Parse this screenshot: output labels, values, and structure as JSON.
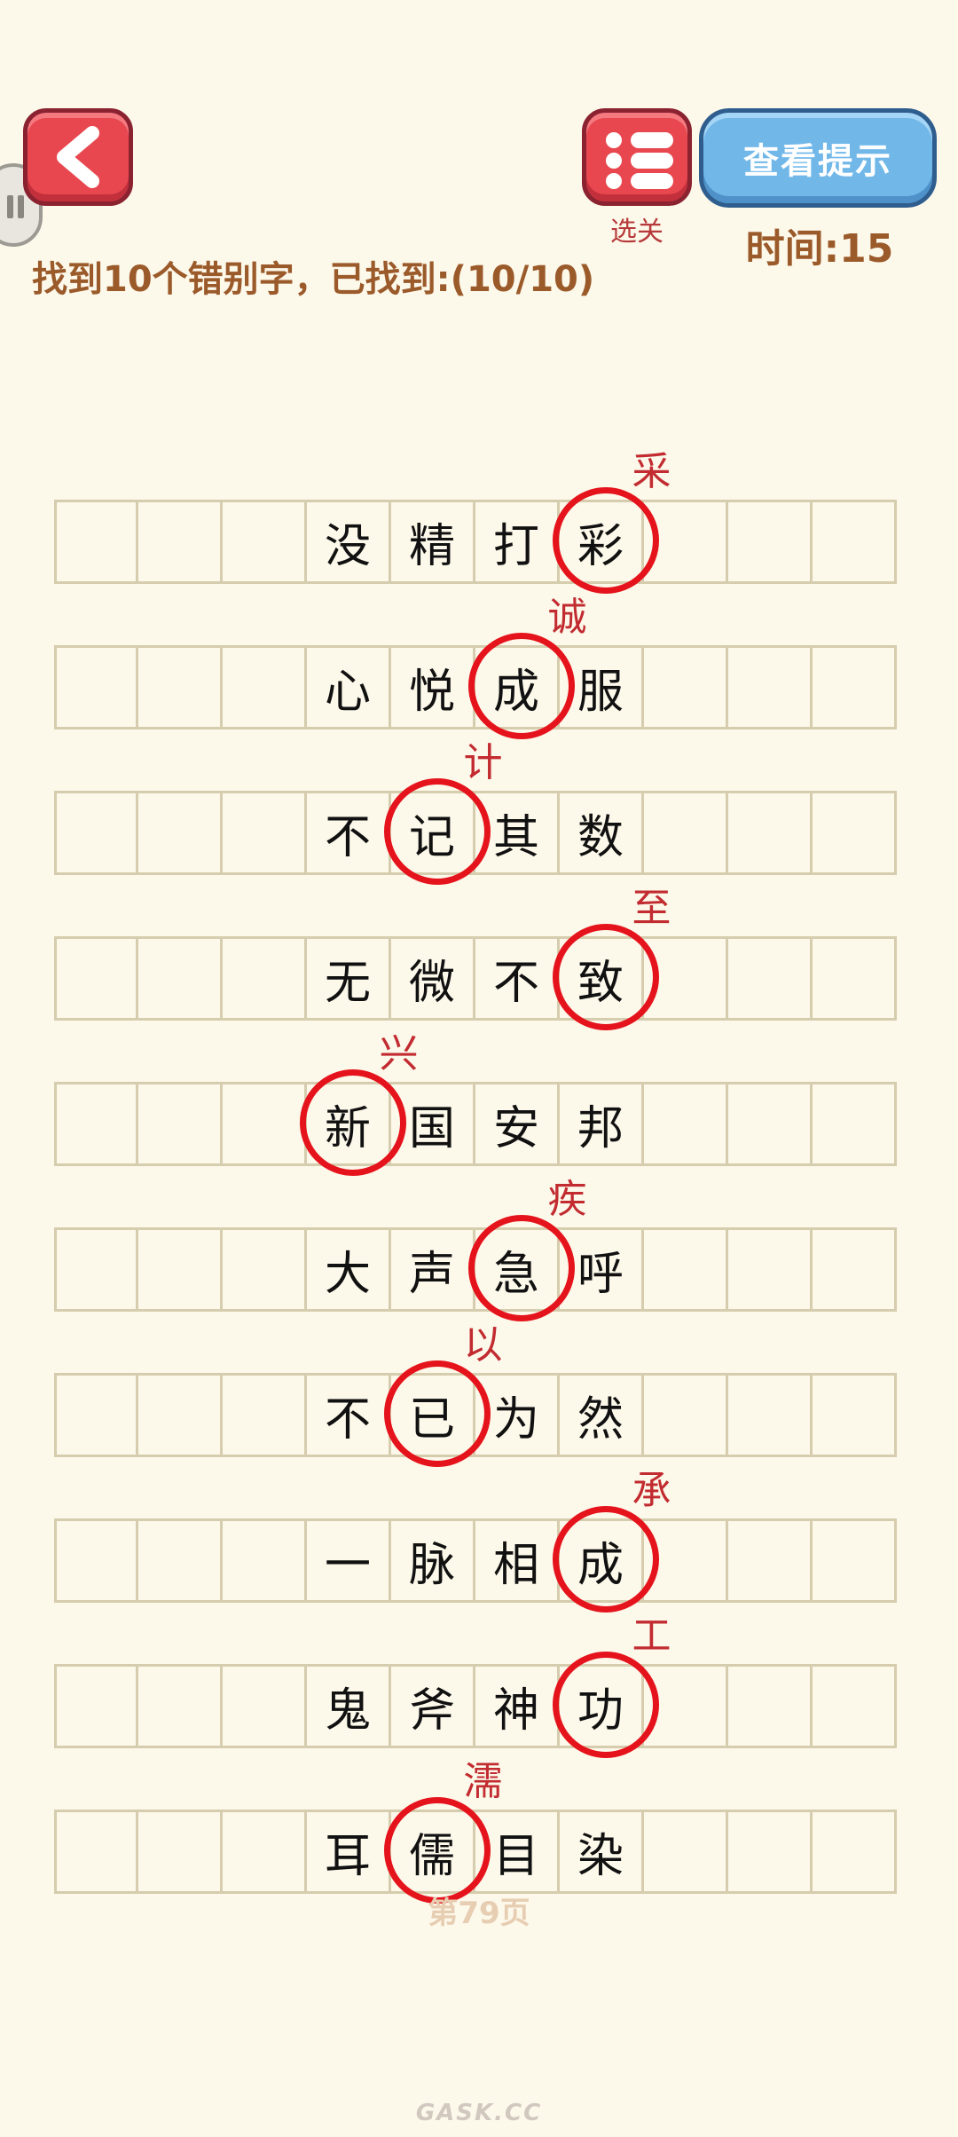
{
  "header": {
    "hint_label": "查看提示",
    "level_select_label": "选关",
    "timer_text": "时间:15",
    "task_text": "找到10个错别字，已找到:(10/10)"
  },
  "idioms": [
    {
      "chars": [
        "没",
        "精",
        "打",
        "彩"
      ],
      "wrong_index": 3,
      "correction": "采"
    },
    {
      "chars": [
        "心",
        "悦",
        "成",
        "服"
      ],
      "wrong_index": 2,
      "correction": "诚"
    },
    {
      "chars": [
        "不",
        "记",
        "其",
        "数"
      ],
      "wrong_index": 1,
      "correction": "计"
    },
    {
      "chars": [
        "无",
        "微",
        "不",
        "致"
      ],
      "wrong_index": 3,
      "correction": "至"
    },
    {
      "chars": [
        "新",
        "国",
        "安",
        "邦"
      ],
      "wrong_index": 0,
      "correction": "兴"
    },
    {
      "chars": [
        "大",
        "声",
        "急",
        "呼"
      ],
      "wrong_index": 2,
      "correction": "疾"
    },
    {
      "chars": [
        "不",
        "已",
        "为",
        "然"
      ],
      "wrong_index": 1,
      "correction": "以"
    },
    {
      "chars": [
        "一",
        "脉",
        "相",
        "成"
      ],
      "wrong_index": 3,
      "correction": "承"
    },
    {
      "chars": [
        "鬼",
        "斧",
        "神",
        "功"
      ],
      "wrong_index": 3,
      "correction": "工"
    },
    {
      "chars": [
        "耳",
        "儒",
        "目",
        "染"
      ],
      "wrong_index": 1,
      "correction": "濡"
    }
  ],
  "footer": {
    "page_label": "第79页",
    "watermark": "GASK.CC"
  },
  "colors": {
    "background": "#fcf8ea",
    "accent_red": "#e8474f",
    "hint_blue": "#71b8e9",
    "text_brown": "#9b5a2a",
    "circle_red": "#e5131b"
  }
}
